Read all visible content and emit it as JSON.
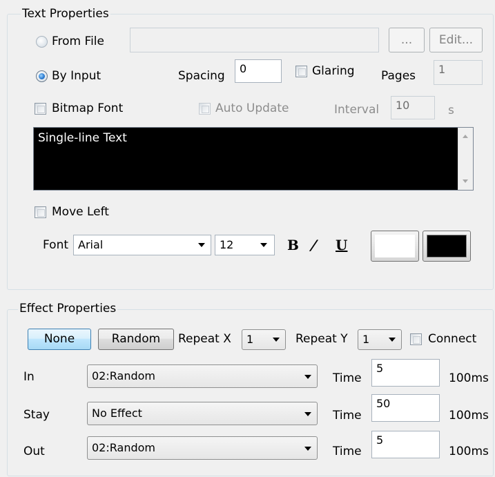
{
  "text_properties": {
    "title": "Text Properties",
    "from_file": {
      "label": "From File",
      "selected": false,
      "path_value": ""
    },
    "browse_label": "...",
    "edit_label": "Edit...",
    "by_input": {
      "label": "By Input",
      "selected": true
    },
    "spacing": {
      "label": "Spacing",
      "value": "0"
    },
    "glaring": {
      "label": "Glaring",
      "checked": false
    },
    "pages": {
      "label": "Pages",
      "value": "1"
    },
    "bitmap_font": {
      "label": "Bitmap Font",
      "checked": false
    },
    "auto_update": {
      "label": "Auto Update",
      "checked": false
    },
    "interval": {
      "label": "Interval",
      "value": "10",
      "unit": "s"
    },
    "text_content": "Single-line Text",
    "move_left": {
      "label": "Move Left",
      "checked": false
    },
    "font": {
      "label": "Font",
      "family": "Arial",
      "size": "12"
    },
    "format": {
      "bold": "B",
      "italic": "/",
      "underline": "U"
    },
    "colors": {
      "foreground": "#ffffff",
      "background": "#000000"
    }
  },
  "effect_properties": {
    "title": "Effect Properties",
    "none_label": "None",
    "random_label": "Random",
    "repeat_x": {
      "label": "Repeat X",
      "value": "1"
    },
    "repeat_y": {
      "label": "Repeat Y",
      "value": "1"
    },
    "connect": {
      "label": "Connect",
      "checked": false
    },
    "rows": [
      {
        "label": "In",
        "effect": "02:Random",
        "time_label": "Time",
        "time": "5",
        "unit": "100ms"
      },
      {
        "label": "Stay",
        "effect": "No Effect",
        "time_label": "Time",
        "time": "50",
        "unit": "100ms"
      },
      {
        "label": "Out",
        "effect": "02:Random",
        "time_label": "Time",
        "time": "5",
        "unit": "100ms"
      }
    ]
  }
}
